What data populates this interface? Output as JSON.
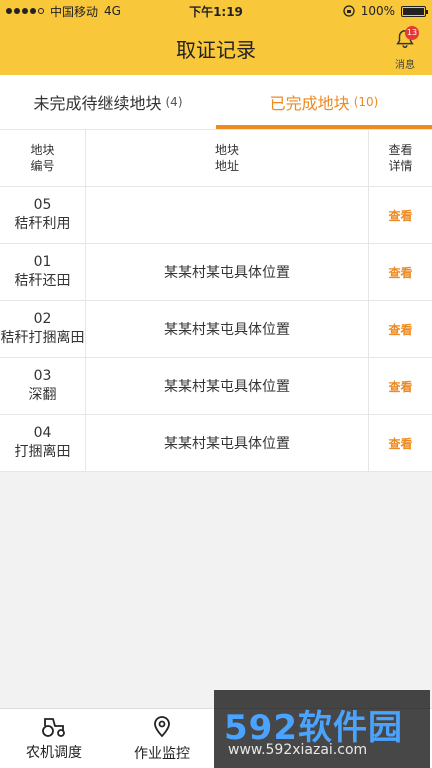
{
  "status": {
    "carrier": "中国移动",
    "network": "4G",
    "time": "下午1:19",
    "battery": "100%",
    "battery_level": 1.0
  },
  "header": {
    "title": "取证记录",
    "message_label": "消息",
    "message_badge": "13"
  },
  "tabs": [
    {
      "label": "未完成待继续地块",
      "count": "(4)"
    },
    {
      "label": "已完成地块",
      "count": "(10)"
    }
  ],
  "table": {
    "headers": {
      "col1_line1": "地块",
      "col1_line2": "编号",
      "col2_line1": "地块",
      "col2_line2": "地址",
      "col3_line1": "查看",
      "col3_line2": "详情"
    },
    "rows": [
      {
        "num": "05",
        "type": "秸秆利用",
        "address": "",
        "action": "查看"
      },
      {
        "num": "01",
        "type": "秸秆还田",
        "address": "某某村某屯具体位置",
        "action": "查看"
      },
      {
        "num": "02",
        "type": "秸秆打捆离田",
        "address": "某某村某屯具体位置",
        "action": "查看"
      },
      {
        "num": "03",
        "type": "深翻",
        "address": "某某村某屯具体位置",
        "action": "查看"
      },
      {
        "num": "04",
        "type": "打捆离田",
        "address": "某某村某屯具体位置",
        "action": "查看"
      }
    ]
  },
  "bottom_nav": [
    {
      "label": "农机调度"
    },
    {
      "label": "作业监控"
    }
  ],
  "watermark": {
    "main": "592软件园",
    "url": "www.592xiazai.com"
  },
  "colors": {
    "header_bg": "#f8c73a",
    "accent": "#ee8a22",
    "badge": "#e53935"
  }
}
